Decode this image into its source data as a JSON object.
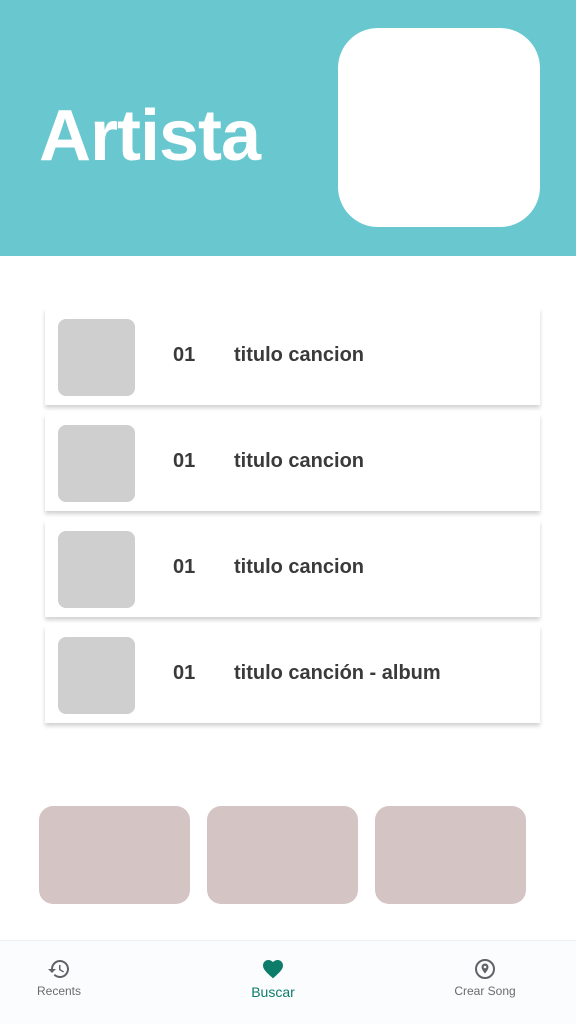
{
  "colors": {
    "header_bg": "#69c7cf",
    "accent": "#0e7c6b",
    "thumb": "#cfcfcf",
    "card": "#d4c5c4"
  },
  "header": {
    "title": "Artista"
  },
  "songs": [
    {
      "number": "01",
      "title": "titulo cancion"
    },
    {
      "number": "01",
      "title": "titulo cancion"
    },
    {
      "number": "01",
      "title": "titulo cancion"
    },
    {
      "number": "01",
      "title": "titulo canción - album"
    }
  ],
  "nav": {
    "items": [
      {
        "label": "Recents",
        "icon": "history-icon",
        "active": false
      },
      {
        "label": "Buscar",
        "icon": "heart-icon",
        "active": true
      },
      {
        "label": "Crear Song",
        "icon": "location-pin-icon",
        "active": false
      }
    ]
  }
}
